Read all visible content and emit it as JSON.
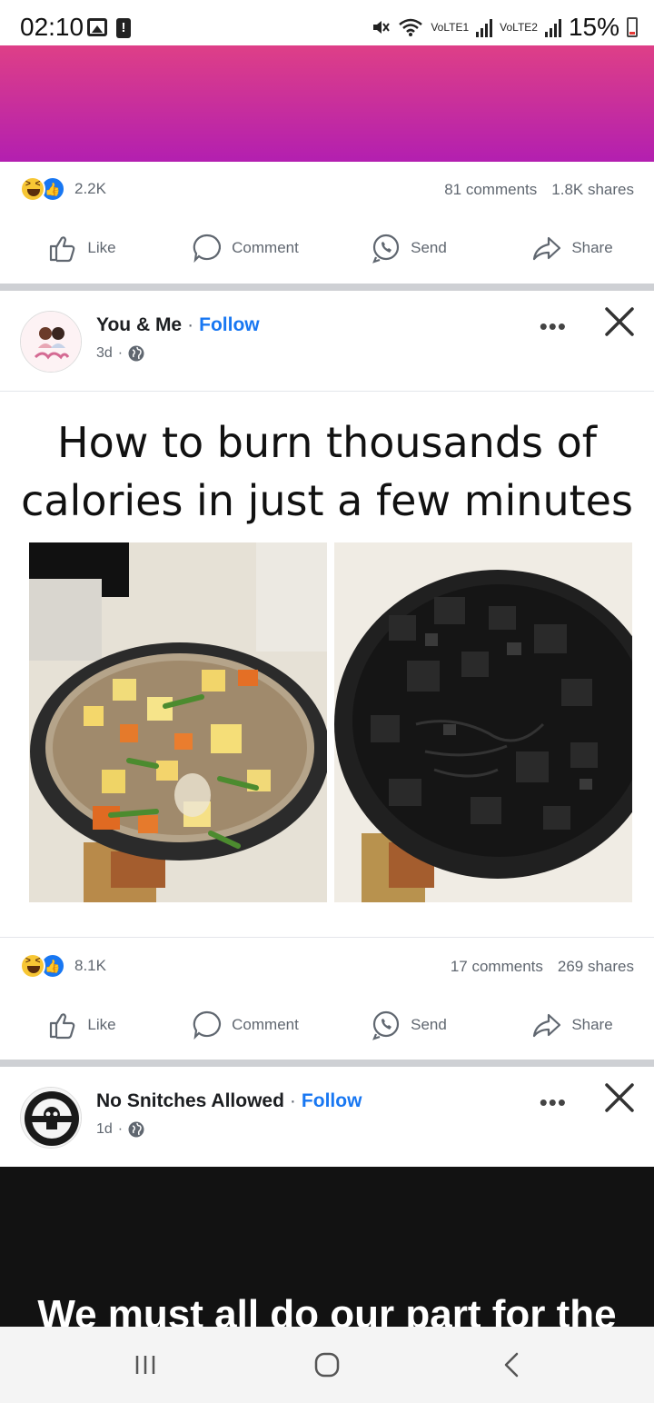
{
  "status_bar": {
    "time": "02:10",
    "network_1": "VoLTE1",
    "network_2": "VoLTE2",
    "battery": "15%"
  },
  "post_1": {
    "reaction_count": "2.2K",
    "comments": "81 comments",
    "shares": "1.8K shares"
  },
  "actions": {
    "like": "Like",
    "comment": "Comment",
    "send": "Send",
    "share": "Share"
  },
  "post_2": {
    "author": "You & Me",
    "follow": "Follow",
    "time": "3d",
    "caption_line_1": "How to burn thousands of",
    "caption_line_2": "calories in just a few minutes",
    "reaction_count": "8.1K",
    "comments": "17 comments",
    "shares": "269 shares"
  },
  "post_3": {
    "author": "No Snitches Allowed",
    "follow": "Follow",
    "time": "1d",
    "caption_partial": "We must all do our part for the"
  },
  "colors": {
    "accent": "#1877f2",
    "gradient_top": "#de3f87",
    "gradient_bottom": "#b31fb0"
  }
}
